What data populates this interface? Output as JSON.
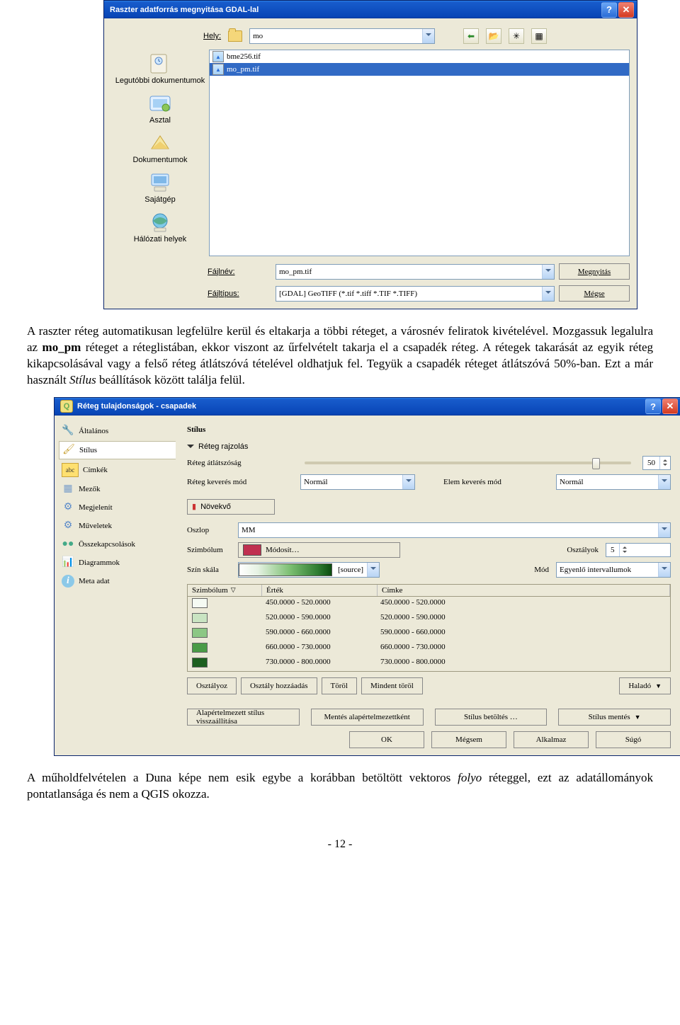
{
  "dialog1": {
    "title": "Raszter adatforrás megnyitása GDAL-lal",
    "locationLabel": "Hely:",
    "locationValue": "mo",
    "sidebar": [
      "Legutóbbi dokumentumok",
      "Asztal",
      "Dokumentumok",
      "Sajátgép",
      "Hálózati helyek"
    ],
    "files": [
      {
        "name": "bme256.tif",
        "selected": false
      },
      {
        "name": "mo_pm.tif",
        "selected": true
      }
    ],
    "filenameLabel": "Fájlnév:",
    "filenameValue": "mo_pm.tif",
    "filetypeLabel": "Fájltípus:",
    "filetypeValue": "[GDAL] GeoTIFF (*.tif *.tiff *.TIF *.TIFF)",
    "openBtn": "Megnyitás",
    "cancelBtn": "Mégse"
  },
  "para1": "A raszter réteg automatikusan legfelülre kerül és eltakarja a többi réteget, a városnév feliratok kivételével. Mozgassuk legalulra az ",
  "para1_bold": "mo_pm",
  "para1_cont": " réteget a réteglistában, ekkor viszont az űrfelvételt takarja el a csapadék réteg. A rétegek takarását az egyik réteg kikapcsolásával vagy a felső réteg átlátszóvá tételével oldhatjuk fel. Tegyük a csapadék réteget átlátszóvá 50%-ban. Ezt a már használt ",
  "para1_it": "Stílus",
  "para1_end": " beállítások között találja felül.",
  "dialog2": {
    "title": "Réteg tulajdonságok - csapadek",
    "nav": [
      "Általános",
      "Stílus",
      "Címkék",
      "Mezők",
      "Megjelenít",
      "Műveletek",
      "Összekapcsolások",
      "Diagrammok",
      "Meta adat"
    ],
    "section": "Stílus",
    "drawing": "Réteg rajzolás",
    "transparencyLabel": "Réteg átlátszóság",
    "transparencyValue": "50",
    "blendLayerLabel": "Réteg keverés mód",
    "blendLayerValue": "Normál",
    "blendFeatureLabel": "Elem keverés mód",
    "blendFeatureValue": "Normál",
    "graduated": "Növekvő",
    "columnLabel": "Oszlop",
    "columnValue": "MM",
    "symbolLabel": "Szimbólum",
    "modifyBtn": "Módosít…",
    "classesLabel": "Osztályok",
    "classesValue": "5",
    "colorRampLabel": "Szín skála",
    "colorRampValue": "[source]",
    "modeLabel": "Mód",
    "modeValue": "Egyenlő intervallumok",
    "tableHeaders": [
      "Szimbólum",
      "Érték",
      "Címke"
    ],
    "tableRows": [
      {
        "c": "#f5faf3",
        "val": "450.0000 - 520.0000",
        "lab": "450.0000 - 520.0000"
      },
      {
        "c": "#c9e4c2",
        "val": "520.0000 - 590.0000",
        "lab": "520.0000 - 590.0000"
      },
      {
        "c": "#8cc784",
        "val": "590.0000 - 660.0000",
        "lab": "590.0000 - 660.0000"
      },
      {
        "c": "#4a9b47",
        "val": "660.0000 - 730.0000",
        "lab": "660.0000 - 730.0000"
      },
      {
        "c": "#1d5f1f",
        "val": "730.0000 - 800.0000",
        "lab": "730.0000 - 800.0000"
      }
    ],
    "btnClassify": "Osztályoz",
    "btnAddClass": "Osztály hozzáadás",
    "btnDelete": "Töröl",
    "btnDeleteAll": "Mindent töröl",
    "btnAdvanced": "Haladó",
    "btnRestore": "Alapértelmezett stílus visszaállítása",
    "btnSaveDef": "Mentés alapértelmezettként",
    "btnLoadStyle": "Stílus betöltés …",
    "btnSaveStyle": "Stílus mentés",
    "btnOK": "OK",
    "btnCancel": "Mégsem",
    "btnApply": "Alkalmaz",
    "btnHelp": "Súgó"
  },
  "para2": "A műholdfelvételen a Duna képe nem esik egybe a korábban betöltött vektoros ",
  "para2_it": "folyo",
  "para2_end": " réteggel, ezt az adatállományok pontatlansága és nem a QGIS okozza.",
  "pagenum": "- 12 -"
}
